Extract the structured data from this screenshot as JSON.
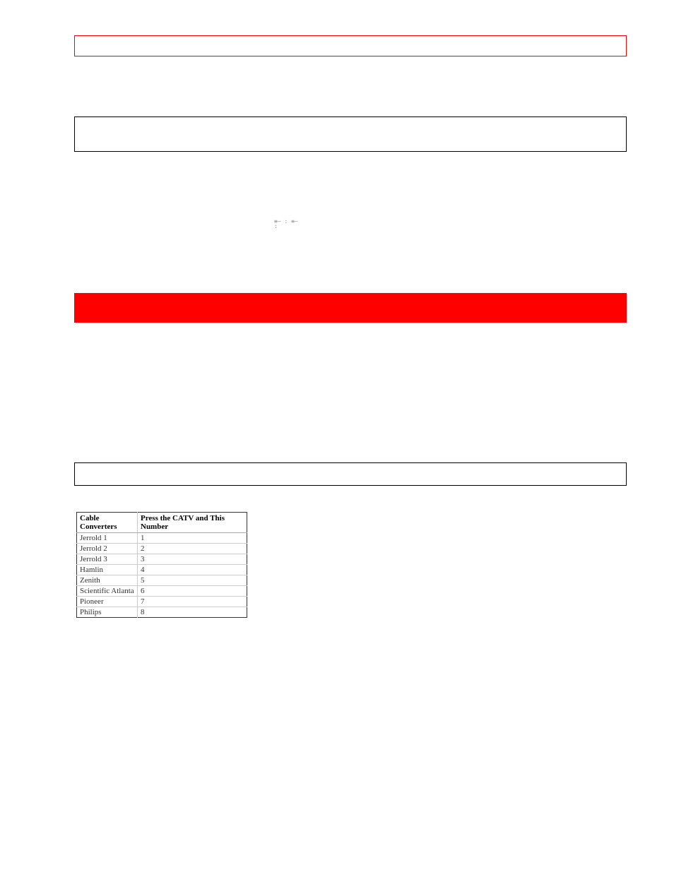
{
  "icon_text": "≡— :\n≡— :",
  "table": {
    "header1": "Cable Converters",
    "header2": "Press the CATV and This Number",
    "rows": [
      {
        "name": "Jerrold 1",
        "num": "1"
      },
      {
        "name": "Jerrold 2",
        "num": "2"
      },
      {
        "name": "Jerrold 3",
        "num": "3"
      },
      {
        "name": "Hamlin",
        "num": "4"
      },
      {
        "name": "Zenith",
        "num": "5"
      },
      {
        "name": "Scientific Atlanta",
        "num": "6"
      },
      {
        "name": "Pioneer",
        "num": "7"
      },
      {
        "name": "Philips",
        "num": "8"
      }
    ]
  }
}
